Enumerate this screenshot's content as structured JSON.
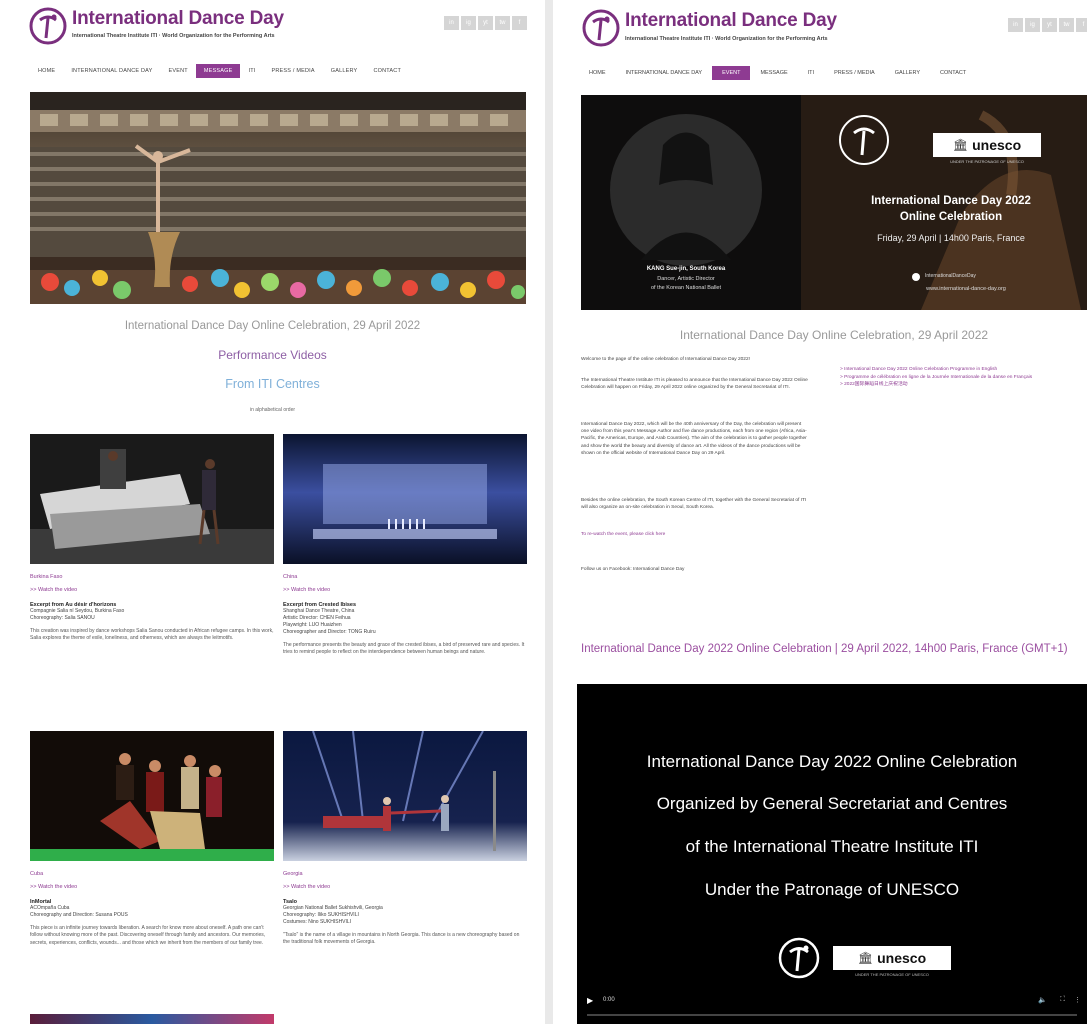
{
  "site": {
    "title": "International Dance Day",
    "subtitle": "International Theatre Institute ITI · World Organization for the Performing Arts",
    "social": [
      "in",
      "ig",
      "yt",
      "tw",
      "f"
    ]
  },
  "left": {
    "nav": [
      "HOME",
      "INTERNATIONAL DANCE DAY",
      "EVENT",
      "MESSAGE",
      "ITI",
      "PRESS / MEDIA",
      "GALLERY",
      "CONTACT"
    ],
    "active_nav": "MESSAGE",
    "caption": "International Dance Day Online Celebration, 29 April 2022",
    "performance_videos": "Performance Videos",
    "from_iti": "From ITI Centres",
    "alphabetical": "in alphabetical order",
    "cards": [
      {
        "country": "Burkina Faso",
        "watch": ">> Watch the video",
        "title": "Excerpt from Au désir d'horizons",
        "credits": [
          "Compagnie Salia ní Seydou, Burkina Faso",
          "Choreography: Salia SANOU"
        ],
        "desc": "This creation was inspired by dance workshops Salia Sanou conducted in African refugee camps. In this work, Salia explores the theme of exile, loneliness, and otherness, which are always the leitmotifs."
      },
      {
        "country": "China",
        "watch": ">> Watch the video",
        "title": "Excerpt from Crested Ibises",
        "credits": [
          "Shanghai Dance Theatre, China",
          "Artistic Director: CHEN Feihua",
          "Playwright: LUO Huaizhen",
          "Choreographer and Director: TONG Ruiru"
        ],
        "desc": "The performance presents the beauty and grace of the crested ibises, a bird of preserved rare and species. It tries to remind people to reflect on the interdependence between human beings and nature."
      },
      {
        "country": "Cuba",
        "watch": ">> Watch the video",
        "title": "InMortal",
        "credits": [
          "ACOmpaña Cuba",
          "Choreography and Direction: Susana POUS"
        ],
        "desc": "This piece is an infinite journey towards liberation. A search for know more about oneself. A path one can't follow without knowing more of the past. Discovering oneself through family and ancestors. Our memories, secrets, experiences, conflicts, wounds... and those which we inherit from the members of our family tree."
      },
      {
        "country": "Georgia",
        "watch": ">> Watch the video",
        "title": "Tsalo",
        "credits": [
          "Georgian National Ballet Sukhishvili, Georgia",
          "Choreography: Iliko SUKHISHVILI",
          "Costumes: Nino SUKHISHVILI"
        ],
        "desc": "\"Tsalo\" is the name of a village in mountains in North Georgia. This dance is a new choreography based on the traditional folk movements of Georgia."
      }
    ]
  },
  "right": {
    "nav": [
      "HOME",
      "INTERNATIONAL DANCE DAY",
      "EVENT",
      "MESSAGE",
      "ITI",
      "PRESS / MEDIA",
      "GALLERY",
      "CONTACT"
    ],
    "active_nav": "EVENT",
    "banner": {
      "person_name": "KANG Sue-jin, South Korea",
      "person_role1": "Dancer, Artistic Director",
      "person_role2": "of the Korean National Ballet",
      "unesco": "unesco",
      "unesco_sub": "UNDER THE PATRONAGE OF UNESCO",
      "line1": "International Dance Day 2022",
      "line2": "Online Celebration",
      "line3": "Friday, 29 April | 14h00 Paris, France",
      "fb": "InternationalDanceDay",
      "web": "www.international-dance-day.org"
    },
    "caption": "International Dance Day Online Celebration, 29 April 2022",
    "paras": [
      "Welcome to the page of the online celebration of International Dance Day 2022!",
      "The International Theatre Institute ITI is pleased to announce that the International Dance Day 2022 Online Celebration will happen on Friday, 29 April 2022 online organized by the General Secretariat of ITI.",
      "International Dance Day 2022, which will be the 40th anniversary of the Day, the celebration will present one video from this year's Message Author and five dance productions, each from one region (Africa, Asia-Pacific, the Americas, Europe, and Arab Countries). The aim of the celebration is to gather people together and show the world the beauty and diversity of dance art. All the videos of the dance productions will be shown on the official website of International Dance Day on 29 April.",
      "Besides the online celebration, the South Korean Centre of ITI, together with the General Secretariat of ITI will also organize an on-site celebration in Seoul, South Korea."
    ],
    "watch_event": "To re-watch the event, please click here",
    "follow": "Follow us on Facebook: International Dance Day",
    "links": [
      "> International Dance Day 2022 Online Celebration Programme in English",
      "> Programme de célébration en ligne de la Journée Internationale de la danse en Français",
      "> 2022国际舞蹈日线上庆祝活动"
    ],
    "heading": "International Dance Day 2022 Online Celebration | 29 April 2022, 14h00 Paris, France (GMT+1)",
    "video": {
      "line1": "International Dance Day 2022 Online Celebration",
      "line2": "Organized by General Secretariat and Centres",
      "line3": "of the International Theatre Institute ITI",
      "line4": "Under the Patronage of UNESCO",
      "unesco": "unesco",
      "unesco_sub": "UNDER THE PATRONAGE OF UNESCO",
      "time": "0:00"
    }
  }
}
